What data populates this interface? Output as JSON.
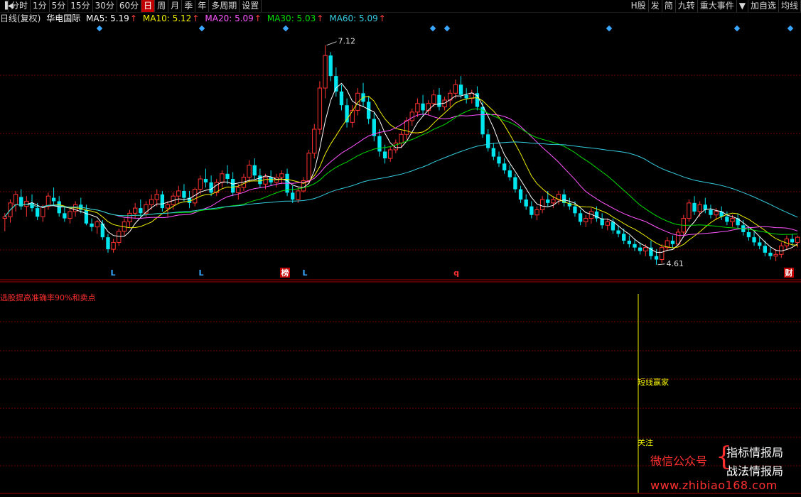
{
  "toolbar": {
    "left": [
      {
        "id": "fs",
        "label": "分时"
      },
      {
        "id": "1m",
        "label": "1分"
      },
      {
        "id": "5m",
        "label": "5分"
      },
      {
        "id": "15m",
        "label": "15分"
      },
      {
        "id": "30m",
        "label": "30分"
      },
      {
        "id": "60m",
        "label": "60分"
      },
      {
        "id": "day",
        "label": "日",
        "active": true
      },
      {
        "id": "week",
        "label": "周"
      },
      {
        "id": "month",
        "label": "月"
      },
      {
        "id": "season",
        "label": "季"
      },
      {
        "id": "year",
        "label": "年"
      },
      {
        "id": "multi",
        "label": "多周期"
      },
      {
        "id": "settings",
        "label": "设置"
      }
    ],
    "right": [
      {
        "id": "hshare",
        "label": "H股"
      },
      {
        "id": "fa",
        "label": "发"
      },
      {
        "id": "jian",
        "label": "简"
      },
      {
        "id": "jiuzhuan",
        "label": "九转"
      },
      {
        "id": "events",
        "label": "重大事件"
      },
      {
        "id": "dropdown",
        "label": "▼"
      },
      {
        "id": "addwatch",
        "label": "加自选"
      },
      {
        "id": "junxian",
        "label": "均线"
      }
    ]
  },
  "info": {
    "period": "日线(复权)",
    "stock_name": "华电国际",
    "ma": [
      {
        "label": "MA5: 5.19",
        "color": "#ffffff"
      },
      {
        "label": "MA10: 5.12",
        "color": "#f0f000"
      },
      {
        "label": "MA20: 5.09",
        "color": "#ff55ff"
      },
      {
        "label": "MA30: 5.03",
        "color": "#00dd00"
      },
      {
        "label": "MA60: 5.09",
        "color": "#33ccdd"
      }
    ],
    "arrow": "↑"
  },
  "price": {
    "high_label": "7.12",
    "low_label": "4.61"
  },
  "markers": {
    "L": "L",
    "bang": "榜",
    "q": "q",
    "cai": "财"
  },
  "indicator": {
    "title": "选股提高准确率90%和卖点",
    "signal_1": "短线赢家",
    "signal_2": "关注"
  },
  "watermark": {
    "wechat": "微信公众号",
    "brace": "{",
    "name_1": "指标情报局",
    "name_2": "战法情报局",
    "url": "www.zhibiao168.com"
  },
  "colors": {
    "up": "#ff3232",
    "down": "#00e5ee",
    "ma5": "#ffffff",
    "ma10": "#f0f000",
    "ma20": "#ff55ff",
    "ma30": "#00dd00",
    "ma60": "#33ccdd",
    "grid": "#7a0000",
    "diamond": "#3aa7ff"
  },
  "chart_data": {
    "type": "candlestick",
    "title": "华电国际",
    "period": "日线(复权)",
    "y_range": [
      4.55,
      7.2
    ],
    "annotated_high": 7.12,
    "annotated_low": 4.61,
    "ma_latest": {
      "MA5": 5.19,
      "MA10": 5.12,
      "MA20": 5.09,
      "MA30": 5.03,
      "MA60": 5.09
    },
    "ohlc": [
      [
        5.1,
        5.16,
        4.95,
        5.12
      ],
      [
        5.12,
        5.32,
        5.05,
        5.28
      ],
      [
        5.26,
        5.42,
        5.18,
        5.38
      ],
      [
        5.35,
        5.44,
        5.2,
        5.24
      ],
      [
        5.24,
        5.36,
        5.12,
        5.3
      ],
      [
        5.28,
        5.38,
        5.18,
        5.22
      ],
      [
        5.22,
        5.28,
        5.08,
        5.12
      ],
      [
        5.12,
        5.26,
        5.06,
        5.24
      ],
      [
        5.24,
        5.4,
        5.2,
        5.36
      ],
      [
        5.34,
        5.46,
        5.26,
        5.3
      ],
      [
        5.3,
        5.36,
        5.12,
        5.16
      ],
      [
        5.16,
        5.24,
        5.06,
        5.1
      ],
      [
        5.1,
        5.22,
        5.04,
        5.18
      ],
      [
        5.18,
        5.3,
        5.12,
        5.26
      ],
      [
        5.26,
        5.34,
        5.16,
        5.2
      ],
      [
        5.2,
        5.26,
        5.02,
        5.04
      ],
      [
        5.04,
        5.1,
        4.95,
        5.0
      ],
      [
        5.0,
        5.08,
        4.92,
        5.06
      ],
      [
        5.04,
        5.08,
        4.85,
        4.88
      ],
      [
        4.88,
        4.92,
        4.7,
        4.74
      ],
      [
        4.74,
        4.86,
        4.7,
        4.82
      ],
      [
        4.82,
        4.98,
        4.78,
        4.95
      ],
      [
        4.95,
        5.1,
        4.9,
        5.06
      ],
      [
        5.06,
        5.2,
        5.0,
        5.16
      ],
      [
        5.16,
        5.28,
        5.1,
        5.22
      ],
      [
        5.22,
        5.32,
        5.12,
        5.16
      ],
      [
        5.16,
        5.3,
        5.12,
        5.26
      ],
      [
        5.26,
        5.38,
        5.2,
        5.32
      ],
      [
        5.32,
        5.44,
        5.24,
        5.38
      ],
      [
        5.38,
        5.42,
        5.18,
        5.22
      ],
      [
        5.22,
        5.3,
        5.12,
        5.26
      ],
      [
        5.26,
        5.4,
        5.2,
        5.36
      ],
      [
        5.36,
        5.48,
        5.28,
        5.42
      ],
      [
        5.42,
        5.5,
        5.3,
        5.34
      ],
      [
        5.34,
        5.42,
        5.22,
        5.28
      ],
      [
        5.28,
        5.46,
        5.24,
        5.44
      ],
      [
        5.44,
        5.6,
        5.38,
        5.56
      ],
      [
        5.56,
        5.68,
        5.46,
        5.52
      ],
      [
        5.52,
        5.6,
        5.36,
        5.4
      ],
      [
        5.4,
        5.56,
        5.36,
        5.52
      ],
      [
        5.52,
        5.66,
        5.46,
        5.62
      ],
      [
        5.62,
        5.72,
        5.5,
        5.56
      ],
      [
        5.56,
        5.64,
        5.36,
        5.4
      ],
      [
        5.4,
        5.5,
        5.32,
        5.46
      ],
      [
        5.46,
        5.62,
        5.42,
        5.58
      ],
      [
        5.58,
        5.78,
        5.52,
        5.72
      ],
      [
        5.72,
        5.8,
        5.56,
        5.6
      ],
      [
        5.6,
        5.68,
        5.46,
        5.5
      ],
      [
        5.5,
        5.62,
        5.44,
        5.58
      ],
      [
        5.58,
        5.66,
        5.48,
        5.52
      ],
      [
        5.52,
        5.62,
        5.46,
        5.58
      ],
      [
        5.58,
        5.66,
        5.5,
        5.62
      ],
      [
        5.62,
        5.68,
        5.36,
        5.4
      ],
      [
        5.4,
        5.48,
        5.28,
        5.32
      ],
      [
        5.32,
        5.46,
        5.28,
        5.42
      ],
      [
        5.42,
        5.58,
        5.4,
        5.54
      ],
      [
        5.54,
        5.9,
        5.5,
        5.86
      ],
      [
        5.86,
        6.2,
        5.8,
        6.14
      ],
      [
        6.14,
        6.7,
        6.08,
        6.62
      ],
      [
        6.62,
        7.12,
        6.5,
        7.0
      ],
      [
        7.0,
        7.04,
        6.7,
        6.76
      ],
      [
        6.76,
        6.86,
        6.52,
        6.58
      ],
      [
        6.58,
        6.66,
        6.36,
        6.42
      ],
      [
        6.42,
        6.5,
        6.16,
        6.22
      ],
      [
        6.22,
        6.42,
        6.16,
        6.36
      ],
      [
        6.36,
        6.62,
        6.3,
        6.56
      ],
      [
        6.56,
        6.68,
        6.4,
        6.46
      ],
      [
        6.46,
        6.52,
        6.2,
        6.26
      ],
      [
        6.26,
        6.34,
        6.0,
        6.06
      ],
      [
        6.06,
        6.14,
        5.82,
        5.88
      ],
      [
        5.88,
        5.96,
        5.74,
        5.8
      ],
      [
        5.8,
        5.94,
        5.76,
        5.9
      ],
      [
        5.9,
        6.02,
        5.86,
        5.98
      ],
      [
        5.98,
        6.12,
        5.92,
        6.08
      ],
      [
        6.08,
        6.28,
        6.02,
        6.24
      ],
      [
        6.24,
        6.38,
        6.18,
        6.34
      ],
      [
        6.34,
        6.5,
        6.28,
        6.44
      ],
      [
        6.44,
        6.54,
        6.3,
        6.36
      ],
      [
        6.36,
        6.48,
        6.3,
        6.44
      ],
      [
        6.44,
        6.6,
        6.4,
        6.54
      ],
      [
        6.54,
        6.62,
        6.36,
        6.4
      ],
      [
        6.4,
        6.52,
        6.36,
        6.48
      ],
      [
        6.48,
        6.6,
        6.4,
        6.56
      ],
      [
        6.56,
        6.72,
        6.5,
        6.66
      ],
      [
        6.66,
        6.76,
        6.5,
        6.54
      ],
      [
        6.54,
        6.62,
        6.44,
        6.5
      ],
      [
        6.5,
        6.6,
        6.44,
        6.56
      ],
      [
        6.56,
        6.64,
        6.36,
        6.4
      ],
      [
        6.4,
        6.46,
        6.04,
        6.08
      ],
      [
        6.08,
        6.14,
        5.88,
        5.92
      ],
      [
        5.92,
        5.98,
        5.78,
        5.82
      ],
      [
        5.82,
        5.88,
        5.7,
        5.74
      ],
      [
        5.74,
        5.8,
        5.62,
        5.66
      ],
      [
        5.66,
        5.72,
        5.54,
        5.58
      ],
      [
        5.58,
        5.62,
        5.4,
        5.44
      ],
      [
        5.44,
        5.48,
        5.28,
        5.32
      ],
      [
        5.32,
        5.38,
        5.2,
        5.24
      ],
      [
        5.24,
        5.3,
        5.1,
        5.14
      ],
      [
        5.14,
        5.24,
        5.08,
        5.2
      ],
      [
        5.2,
        5.36,
        5.16,
        5.32
      ],
      [
        5.32,
        5.42,
        5.24,
        5.28
      ],
      [
        5.28,
        5.36,
        5.22,
        5.32
      ],
      [
        5.32,
        5.42,
        5.26,
        5.38
      ],
      [
        5.38,
        5.44,
        5.24,
        5.28
      ],
      [
        5.28,
        5.34,
        5.2,
        5.24
      ],
      [
        5.24,
        5.3,
        5.12,
        5.16
      ],
      [
        5.16,
        5.2,
        5.02,
        5.06
      ],
      [
        5.06,
        5.14,
        5.0,
        5.1
      ],
      [
        5.1,
        5.22,
        5.04,
        5.18
      ],
      [
        5.18,
        5.24,
        5.06,
        5.1
      ],
      [
        5.1,
        5.16,
        4.98,
        5.02
      ],
      [
        5.02,
        5.1,
        4.96,
        5.06
      ],
      [
        5.06,
        5.1,
        4.92,
        4.96
      ],
      [
        4.96,
        5.02,
        4.88,
        4.92
      ],
      [
        4.92,
        4.98,
        4.8,
        4.84
      ],
      [
        4.84,
        4.9,
        4.76,
        4.8
      ],
      [
        4.8,
        4.86,
        4.72,
        4.76
      ],
      [
        4.76,
        4.82,
        4.68,
        4.72
      ],
      [
        4.72,
        4.8,
        4.66,
        4.76
      ],
      [
        4.76,
        4.84,
        4.62,
        4.66
      ],
      [
        4.66,
        4.74,
        4.56,
        4.62
      ],
      [
        4.62,
        4.8,
        4.58,
        4.76
      ],
      [
        4.76,
        4.88,
        4.72,
        4.84
      ],
      [
        4.84,
        4.9,
        4.76,
        4.8
      ],
      [
        4.8,
        4.98,
        4.78,
        4.94
      ],
      [
        4.94,
        5.14,
        4.9,
        5.1
      ],
      [
        5.1,
        5.32,
        5.06,
        5.28
      ],
      [
        5.28,
        5.36,
        5.14,
        5.18
      ],
      [
        5.18,
        5.3,
        5.12,
        5.26
      ],
      [
        5.26,
        5.34,
        5.16,
        5.2
      ],
      [
        5.2,
        5.26,
        5.1,
        5.14
      ],
      [
        5.14,
        5.22,
        5.08,
        5.18
      ],
      [
        5.18,
        5.24,
        5.08,
        5.12
      ],
      [
        5.12,
        5.18,
        5.02,
        5.06
      ],
      [
        5.06,
        5.14,
        5.0,
        5.1
      ],
      [
        5.1,
        5.16,
        4.98,
        5.02
      ],
      [
        5.02,
        5.08,
        4.9,
        4.94
      ],
      [
        4.94,
        5.0,
        4.84,
        4.88
      ],
      [
        4.88,
        4.94,
        4.78,
        4.82
      ],
      [
        4.82,
        4.88,
        4.74,
        4.78
      ],
      [
        4.78,
        4.84,
        4.66,
        4.7
      ],
      [
        4.7,
        4.76,
        4.62,
        4.66
      ],
      [
        4.66,
        4.74,
        4.6,
        4.68
      ],
      [
        4.68,
        4.82,
        4.64,
        4.78
      ],
      [
        4.78,
        4.9,
        4.74,
        4.86
      ],
      [
        4.86,
        4.92,
        4.78,
        4.82
      ],
      [
        4.82,
        4.9,
        4.76,
        4.88
      ]
    ]
  }
}
